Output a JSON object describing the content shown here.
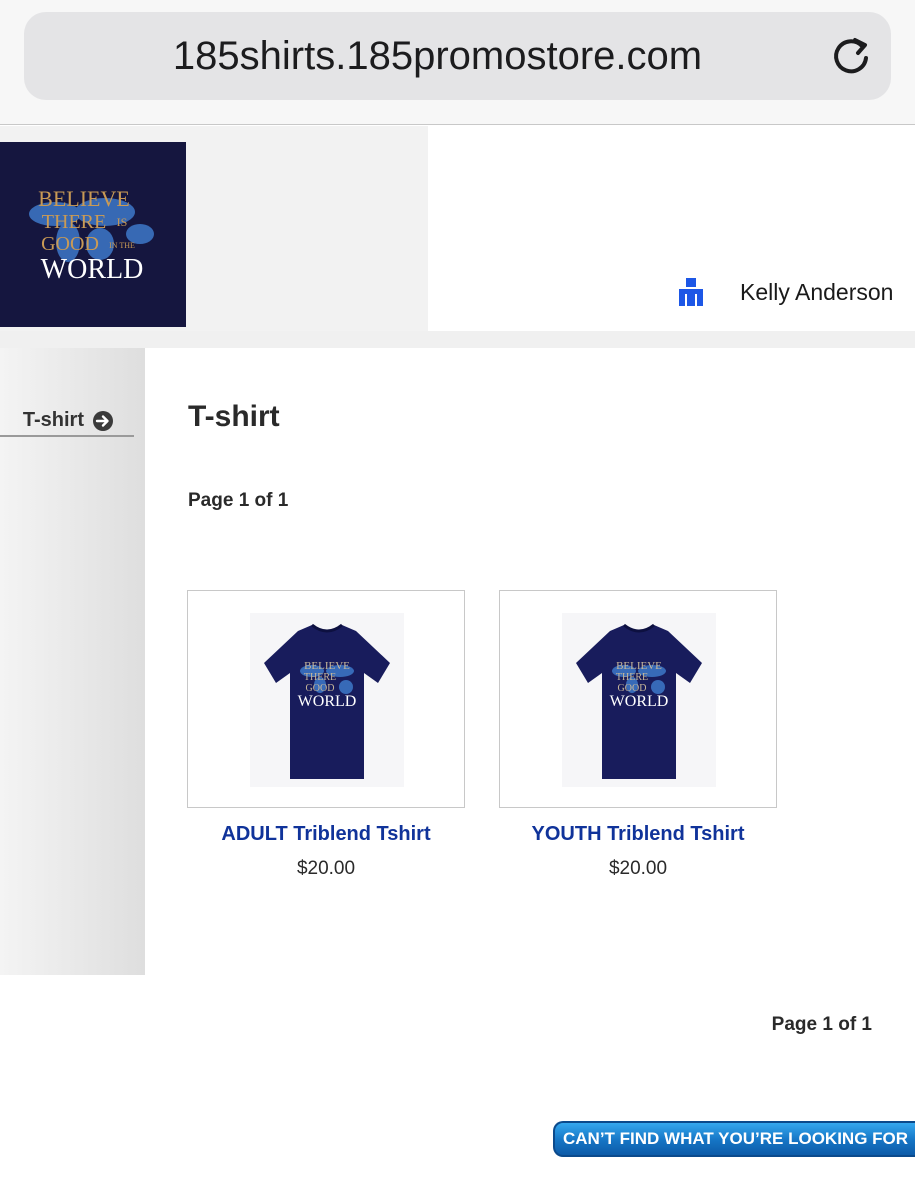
{
  "browser": {
    "url": "185shirts.185promostore.com"
  },
  "header": {
    "logo_lines": [
      "BELIEVE",
      "THERE",
      "IS",
      "GOOD",
      "IN THE",
      "WORLD"
    ],
    "user_name": "Kelly Anderson"
  },
  "sidebar": {
    "items": [
      {
        "label": "T-shirt"
      }
    ]
  },
  "main": {
    "title": "T-shirt",
    "page_info_top": "Page 1 of 1",
    "page_info_bottom": "Page 1 of 1",
    "products": [
      {
        "name": "ADULT Triblend Tshirt",
        "price": "$20.00"
      },
      {
        "name": "YOUTH Triblend Tshirt",
        "price": "$20.00"
      }
    ]
  },
  "help_button": {
    "label": "CAN’T FIND WHAT YOU’RE LOOKING FOR"
  },
  "colors": {
    "logo_background": "#15163f",
    "logo_gold": "#c99a55",
    "shirt_navy": "#181c5c",
    "map_blue": "#3d78c9",
    "product_link": "#10339a",
    "user_icon_blue": "#1d57e6",
    "help_button_blue": "#1574c4"
  }
}
